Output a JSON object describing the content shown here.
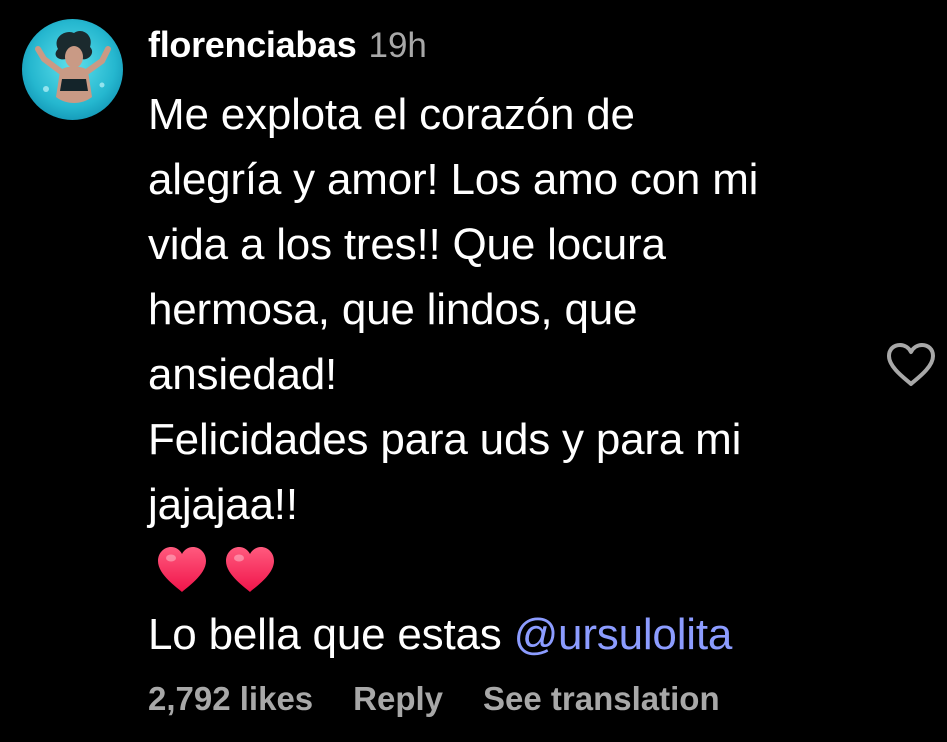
{
  "comment": {
    "username": "florenciabas",
    "timestamp": "19h",
    "avatar_icon": "profile-photo-underwater",
    "text_lines": [
      "Me explota el corazón de",
      "alegría y amor! Los amo con mi",
      "vida a los tres!! Que locura",
      "hermosa, que lindos, que",
      "ansiedad!",
      "Felicidades para uds y para mi",
      "jajajaa!!"
    ],
    "emojis": [
      "heart-emoji",
      "heart-emoji"
    ],
    "last_line_prefix": "Lo bella que estas ",
    "mention": "@ursulolita",
    "mention_color": "#8c9cff",
    "likes": "2,792 likes",
    "reply_label": "Reply",
    "translation_label": "See translation",
    "like_icon": "heart-outline-icon"
  },
  "colors": {
    "background": "#000000",
    "text": "#ffffff",
    "muted": "#a8a8a8",
    "heart_emoji": "#ff2f5f"
  }
}
